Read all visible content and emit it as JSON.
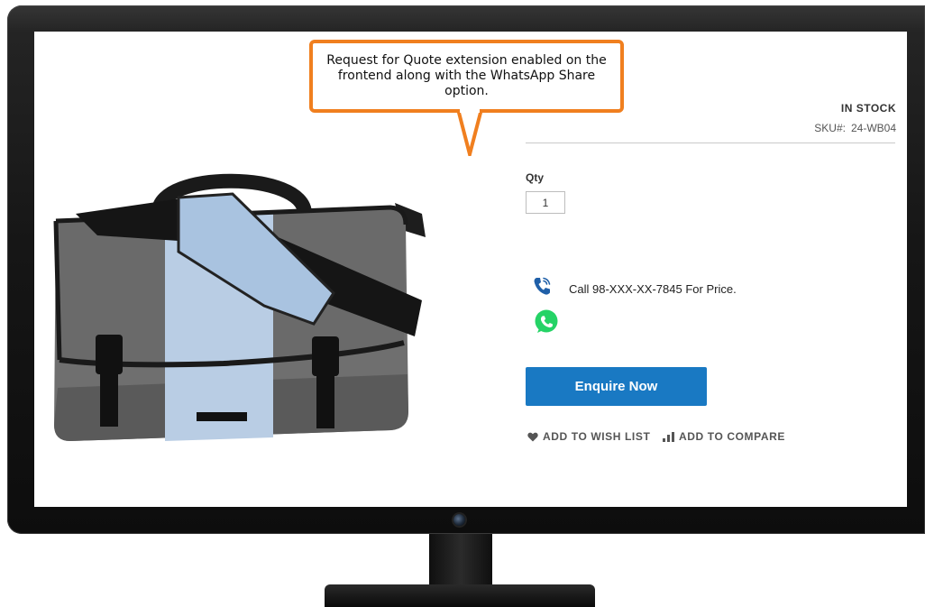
{
  "callout": {
    "text": "Request for Quote extension enabled on the frontend along with the WhatsApp Share option.",
    "border_color": "#f07f1f"
  },
  "product": {
    "stock_status": "IN STOCK",
    "sku_label": "SKU#:",
    "sku_value": "24-WB04",
    "qty_label": "Qty",
    "qty_value": "1",
    "image_icon": "messenger-bag-image"
  },
  "contact": {
    "phone_icon": "phone-icon",
    "call_text": "Call 98-XXX-XX-7845 For Price.",
    "whatsapp_icon": "whatsapp-icon",
    "whatsapp_color": "#25d366"
  },
  "actions": {
    "enquire_label": "Enquire Now",
    "enquire_color": "#1979c3",
    "wishlist_label": "ADD TO WISH LIST",
    "compare_label": "ADD TO COMPARE"
  }
}
